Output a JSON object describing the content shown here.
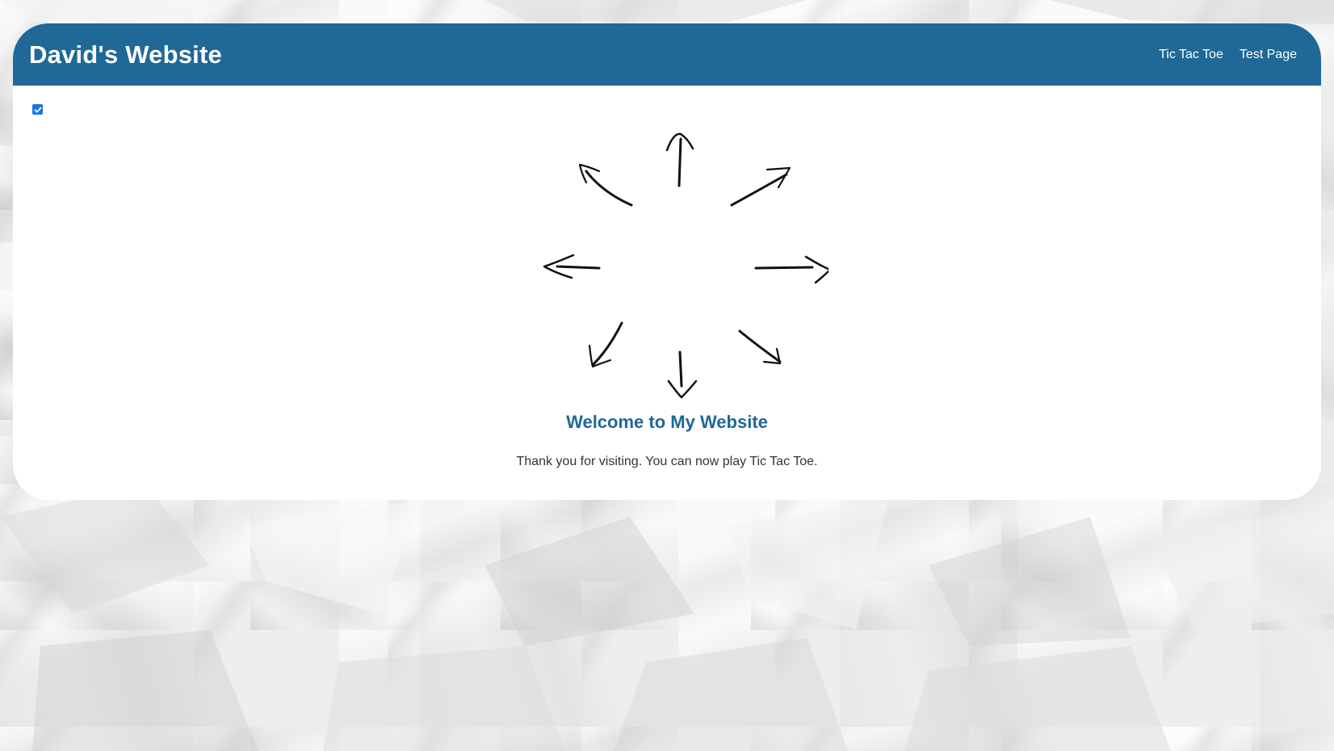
{
  "header": {
    "title": "David's Website",
    "nav": [
      {
        "label": "Tic Tac Toe"
      },
      {
        "label": "Test Page"
      }
    ]
  },
  "toggle": {
    "checked": true
  },
  "main": {
    "heading": "Welcome to My Website",
    "message": "Thank you for visiting. You can now play Tic Tac Toe."
  },
  "colors": {
    "header_bg": "#1f6898",
    "heading": "#1f6898",
    "checkbox": "#1a73e8",
    "card_bg": "#ffffff"
  },
  "icons": {
    "arrows": "hand-drawn-arrows-radiating-outward"
  }
}
